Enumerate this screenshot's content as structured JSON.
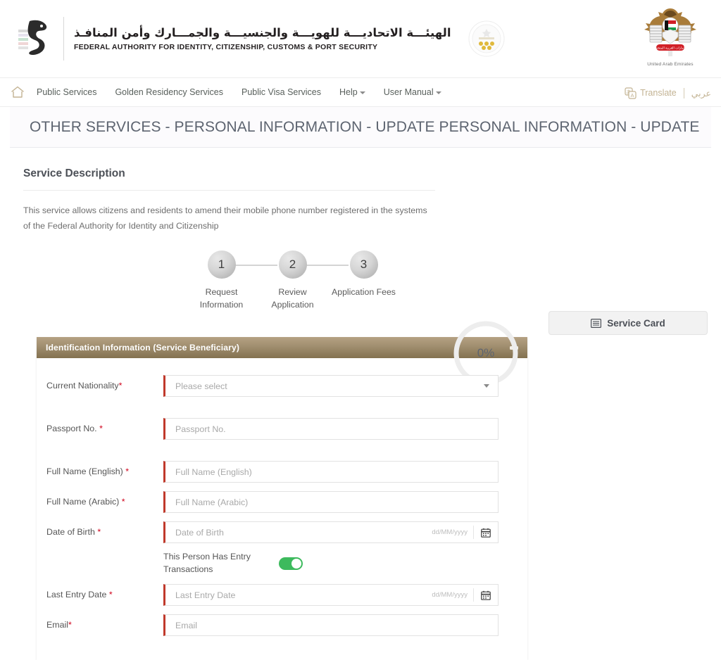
{
  "header": {
    "logo_arabic": "الهيئـــة الاتحاديـــة للهويـــة والجنسيـــة والجمـــارك وأمن المنافـذ",
    "logo_english": "FEDERAL AUTHORITY FOR IDENTITY, CITIZENSHIP, CUSTOMS & PORT SECURITY",
    "emblem_caption": "United Arab Emirates",
    "falcon_logo_icon": "falcon-logo-icon",
    "gcc_emblem_icon": "gcc-emblem-icon",
    "uae_emblem_icon": "uae-emblem-icon"
  },
  "nav": {
    "home_icon": "home-icon",
    "items": [
      {
        "label": "Public Services",
        "has_caret": false
      },
      {
        "label": "Golden Residency Services",
        "has_caret": false
      },
      {
        "label": "Public Visa Services",
        "has_caret": false
      },
      {
        "label": "Help",
        "has_caret": true
      },
      {
        "label": "User Manual",
        "has_caret": true
      }
    ],
    "translate_label": "Translate",
    "translate_icon": "translate-icon",
    "arabic_label": "عربي"
  },
  "page_title": "OTHER SERVICES - PERSONAL INFORMATION - UPDATE PERSONAL INFORMATION - UPDATE",
  "service_description": {
    "heading": "Service Description",
    "body": "This service allows citizens and residents to amend their mobile phone number registered in the systems of the Federal Authority for Identity and Citizenship"
  },
  "progress": {
    "percent_label": "0%",
    "percent_value": 0,
    "track_color": "#ededed"
  },
  "service_card_button": {
    "label": "Service Card",
    "icon": "service-card-icon"
  },
  "stepper": {
    "steps": [
      {
        "number": "1",
        "label": "Request\nInformation"
      },
      {
        "number": "2",
        "label": "Review\nApplication"
      },
      {
        "number": "3",
        "label": "Application Fees"
      }
    ]
  },
  "form_panel": {
    "title": "Identification Information (Service Beneficiary)",
    "collapse_icon": "minus-icon",
    "header_color": "#8d7a59",
    "required_marker_color": "#c0392b",
    "fields": [
      {
        "label": "Current Nationality",
        "required": true,
        "required_mark": "*",
        "type": "select",
        "placeholder": "Please select",
        "value": ""
      },
      {
        "label": "Passport No.",
        "required": true,
        "required_mark": "*",
        "type": "text",
        "placeholder": "Passport No.",
        "value": ""
      },
      {
        "label": "Full Name (English)",
        "required": true,
        "required_mark": "*",
        "type": "text",
        "placeholder": "Full Name (English)",
        "value": ""
      },
      {
        "label": "Full Name (Arabic)",
        "required": true,
        "required_mark": "*",
        "type": "text",
        "placeholder": "Full Name (Arabic)",
        "value": ""
      },
      {
        "label": "Date of Birth",
        "required": true,
        "required_mark": "*",
        "type": "date",
        "placeholder": "Date of Birth",
        "format_hint": "dd/MM/yyyy",
        "value": ""
      }
    ],
    "toggle": {
      "label": "This Person Has Entry Transactions",
      "state": "on",
      "on_color": "#3dba5d"
    },
    "fields_after_toggle": [
      {
        "label": "Last Entry Date",
        "required": true,
        "required_mark": "*",
        "type": "date",
        "placeholder": "Last Entry Date",
        "format_hint": "dd/MM/yyyy",
        "value": ""
      },
      {
        "label": "Email",
        "required": true,
        "required_mark": "*",
        "required_attached": true,
        "type": "text",
        "placeholder": "Email",
        "value": ""
      }
    ]
  }
}
